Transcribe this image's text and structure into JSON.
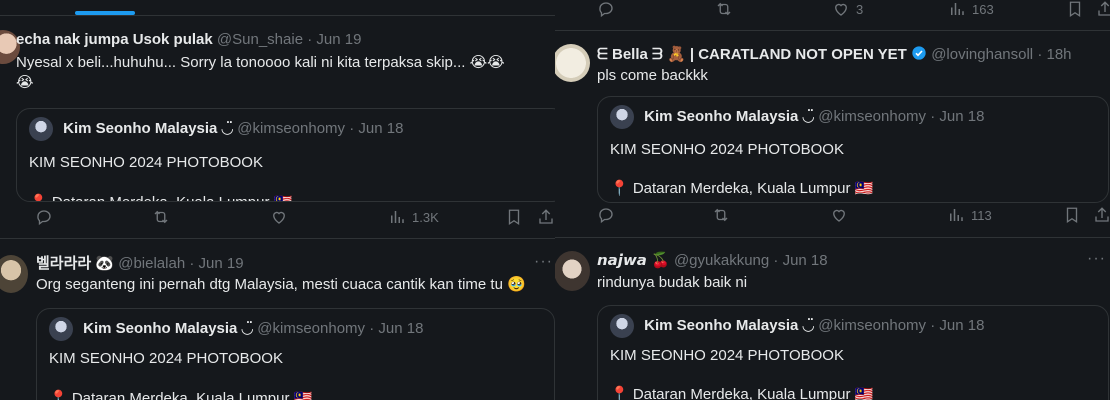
{
  "colors": {
    "accent": "#1d9bf0",
    "bg": "#15181c",
    "border": "#2f3336",
    "muted": "#71767b",
    "text": "#e7e9ea"
  },
  "quoted": {
    "name": "Kim Seonho Malaysia ◡̈",
    "handle": "@kimseonhomy",
    "date": "Jun 18",
    "title": "KIM SEONHO 2024 PHOTOBOOK",
    "location": "📍 Dataran Merdeka, Kuala Lumpur 🇲🇾"
  },
  "left": {
    "tweet1": {
      "name": "echa nak jumpa Usok pulak",
      "handle": "@Sun_shaie",
      "date": "Jun 19",
      "text_line1": "Nyesal x beli...huhuhu... Sorry la tonoooo kali ni kita terpaksa skip... 😭😭",
      "text_line2": "😭",
      "views": "1.3K"
    },
    "tweet2": {
      "name": "벨라라라 🐼",
      "handle": "@bielalah",
      "date": "Jun 19",
      "text": "Org seganteng ini pernah dtg Malaysia, mesti cuaca cantik kan time tu 🥹",
      "more": "···"
    }
  },
  "right": {
    "top_actions": {
      "likes": "3",
      "views": "163"
    },
    "tweet1": {
      "name": "ᗴ Bella ᗱ 🧸 | CARATLAND NOT OPEN YET",
      "handle": "@lovinghansoll",
      "date": "18h",
      "text": "pls come backkk",
      "views": "113"
    },
    "tweet2": {
      "name": "𝙣𝙖𝙟𝙬𝙖 🍒",
      "handle": "@gyukakkung",
      "date": "Jun 18",
      "text": "rindunya budak baik ni",
      "more": "···"
    }
  }
}
